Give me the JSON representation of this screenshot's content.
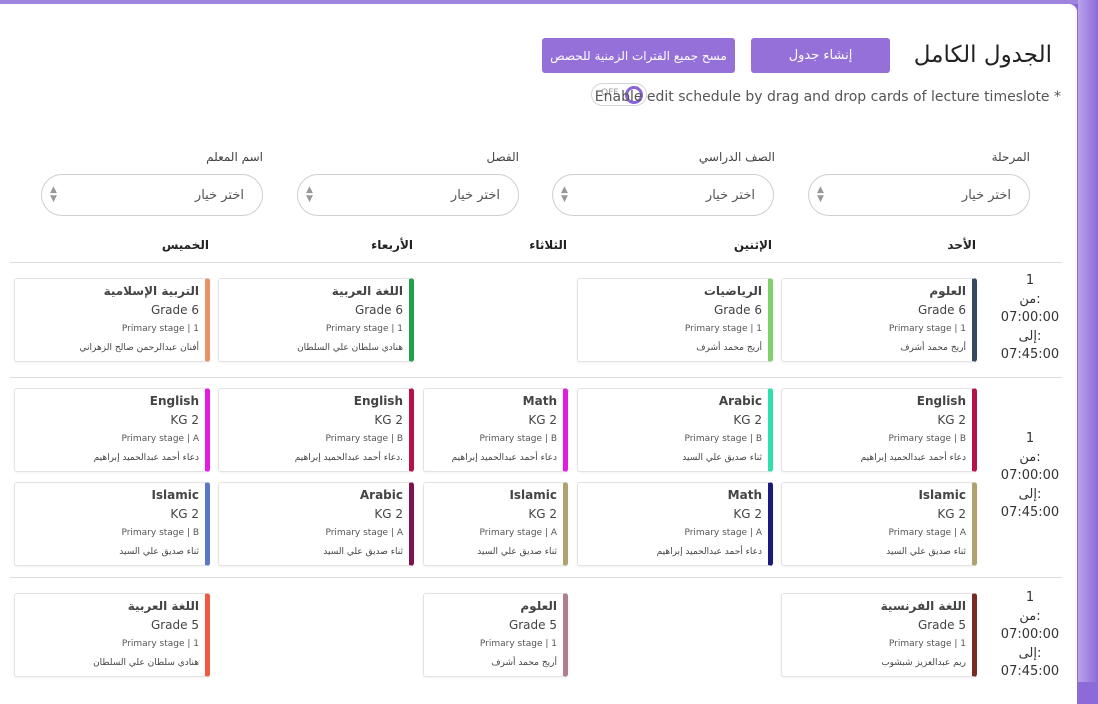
{
  "header": {
    "title": "الجدول الكامل",
    "create_button": "إنشاء جدول",
    "clear_button": "مسح جميع الفترات الزمنية للحصص",
    "toggle_state": "OFF",
    "toggle_hint": "Enable edit schedule by drag and drop cards of lecture timeslote *"
  },
  "filters": [
    {
      "label": "المرحلة",
      "placeholder": "اختر خيار"
    },
    {
      "label": "الصف الدراسي",
      "placeholder": "اختر خيار"
    },
    {
      "label": "الفصل",
      "placeholder": "اختر خيار"
    },
    {
      "label": "اسم المعلم",
      "placeholder": "اختر خيار"
    }
  ],
  "days": [
    "الأحد",
    "الإثنين",
    "الثلاثاء",
    "الأربعاء",
    "الخميس"
  ],
  "periods": [
    {
      "num": "1",
      "from_label": "من:",
      "from": "07:00:00",
      "to_label": "إلى:",
      "to": "07:45:00"
    },
    {
      "num": "1",
      "from_label": "من:",
      "from": "07:00:00",
      "to_label": "إلى:",
      "to": "07:45:00"
    },
    {
      "num": "1",
      "from_label": "من:",
      "from": "07:00:00",
      "to_label": "إلى:",
      "to": "07:45:00"
    }
  ],
  "cards": [
    {
      "subject": "العلوم",
      "grade": "Grade 6",
      "stage": "Primary stage | 1",
      "teacher": "أريج محمد أشرف",
      "color": "#34495e"
    },
    {
      "subject": "الرياضيات",
      "grade": "Grade 6",
      "stage": "Primary stage | 1",
      "teacher": "أريج محمد أشرف",
      "color": "#7fcf6a"
    },
    {
      "subject": "اللغة العربية",
      "grade": "Grade 6",
      "stage": "Primary stage | 1",
      "teacher": "هنادي سلطان علي السلطان",
      "color": "#23a14a"
    },
    {
      "subject": "التربية الإسلامية",
      "grade": "Grade 6",
      "stage": "Primary stage | 1",
      "teacher": "أفنان عبدالرحمن صالح الزهراني",
      "color": "#e8926a"
    },
    {
      "subject": "English",
      "grade": "KG 2",
      "stage": "Primary stage | B",
      "teacher": "دعاء أحمد عبدالحميد إبراهيم",
      "color": "#b3124a"
    },
    {
      "subject": "Arabic",
      "grade": "KG 2",
      "stage": "Primary stage | B",
      "teacher": "ثناء صديق علي السيد",
      "color": "#2fe0ac"
    },
    {
      "subject": "Math",
      "grade": "KG 2",
      "stage": "Primary stage | B",
      "teacher": "دعاء أحمد عبدالحميد إبراهيم",
      "color": "#e21de0"
    },
    {
      "subject": "English",
      "grade": "KG 2",
      "stage": "Primary stage | B",
      "teacher": "دعاء أحمد عبدالحميد إبراهيم.",
      "color": "#b3124a"
    },
    {
      "subject": "English",
      "grade": "KG 2",
      "stage": "Primary stage | A",
      "teacher": "دعاء أحمد عبدالحميد إبراهيم",
      "color": "#e21de0"
    },
    {
      "subject": "Islamic",
      "grade": "KG 2",
      "stage": "Primary stage | A",
      "teacher": "ثناء صديق علي السيد",
      "color": "#b0a270"
    },
    {
      "subject": "Math",
      "grade": "KG 2",
      "stage": "Primary stage | A",
      "teacher": "دعاء أحمد عبدالحميد إبراهيم",
      "color": "#1a1a7a"
    },
    {
      "subject": "Islamic",
      "grade": "KG 2",
      "stage": "Primary stage | A",
      "teacher": "ثناء صديق علي السيد",
      "color": "#b0a270"
    },
    {
      "subject": "Arabic",
      "grade": "KG 2",
      "stage": "Primary stage | A",
      "teacher": "ثناء صديق علي السيد",
      "color": "#7b1450"
    },
    {
      "subject": "Islamic",
      "grade": "KG 2",
      "stage": "Primary stage | B",
      "teacher": "ثناء صديق علي السيد",
      "color": "#5b78c8"
    },
    {
      "subject": "اللغة الفرنسية",
      "grade": "Grade 5",
      "stage": "Primary stage | 1",
      "teacher": "ريم عبدالعزيز شبشوب",
      "color": "#7a2a20"
    },
    {
      "subject": "العلوم",
      "grade": "Grade 5",
      "stage": "Primary stage | 1",
      "teacher": "أريج محمد أشرف",
      "color": "#b17e8e"
    },
    {
      "subject": "اللغة العربية",
      "grade": "Grade 5",
      "stage": "Primary stage | 1",
      "teacher": "هنادي سلطان علي السلطان",
      "color": "#ef5a42"
    }
  ]
}
